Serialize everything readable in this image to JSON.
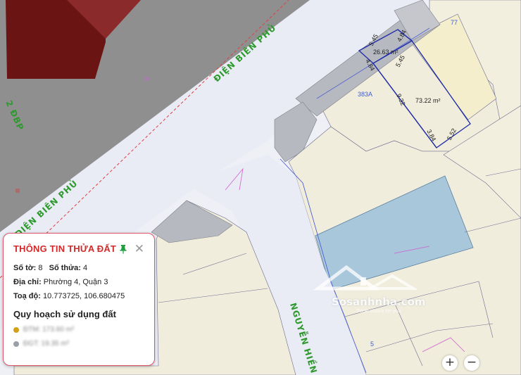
{
  "map": {
    "streets": {
      "dien_bien_phu_top": "ĐIỆN BIÊN PHỦ",
      "dien_bien_phu_left": "ĐIỆN BIÊN PHỦ",
      "dbp_short": "2 ĐBP",
      "nguyen_hien": "NGUYỄN HIỀN"
    },
    "parcels": {
      "area_small": "26.63 m²",
      "area_large": "73.22 m²",
      "house_number": "383A",
      "lot_number_bottom": "5",
      "lot_number_top_right": "77"
    },
    "dimensions": {
      "d1": "5.45",
      "d2": "4.84",
      "d3": "4.84",
      "d4": "5.45",
      "d5": "9.32",
      "d6": "3.84",
      "d7": "5.52"
    }
  },
  "panel": {
    "title": "THÔNG TIN THỬA ĐẤT",
    "so_to_label": "Số tờ:",
    "so_to_value": "8",
    "so_thua_label": "Số thửa:",
    "so_thua_value": "4",
    "dia_chi_label": "Địa chỉ:",
    "dia_chi_value": "Phường 4, Quận 3",
    "toa_do_label": "Toạ độ:",
    "toa_do_value": "10.773725, 106.680475",
    "section_title": "Quy hoạch sử dụng đất",
    "legend": [
      {
        "text": "ĐTM: 173.60 m²",
        "color": "#d4a017"
      },
      {
        "text": "ĐGT: 19.35 m²",
        "color": "#9aa0a6"
      }
    ]
  },
  "watermark": {
    "brand": "Sosanhnha.com",
    "tagline": "Great choice for you"
  },
  "controls": {
    "zoom_in": "+",
    "zoom_out": "−"
  }
}
